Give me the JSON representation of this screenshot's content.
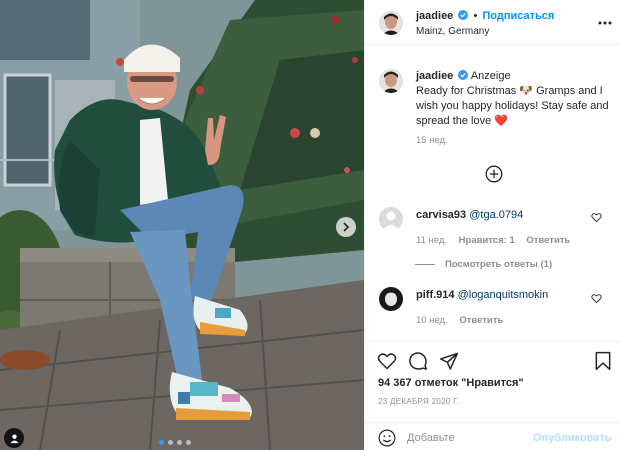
{
  "post": {
    "author": "jaadiee",
    "follow_label": "Подписаться",
    "separator": "•",
    "location": "Mainz, Germany",
    "more_icon": "more-horizontal-icon"
  },
  "caption": {
    "author": "jaadiee",
    "tag": "Anzeige",
    "text_start": "Ready for Christmas",
    "text_end": "Gramps and I wish you happy holidays! Stay safe and spread the love",
    "emoji_1": "🐶",
    "emoji_2": "❤️",
    "time": "15 нед."
  },
  "load_more_icon": "plus-circle-icon",
  "comments": [
    {
      "author": "carvisa93",
      "text": "@tga.0794",
      "time": "11 нед.",
      "likes_label": "Нравится: 1",
      "reply_label": "Ответить",
      "view_replies": "Посмотреть ответы (1)"
    },
    {
      "author": "piff.914",
      "text": "@loganquitsmokin",
      "time": "10 нед.",
      "reply_label": "Ответить"
    }
  ],
  "actions": {
    "likes": "94 367 отметок \"Нравится\"",
    "date": "23 ДЕКАБРЯ 2020 Г."
  },
  "add_comment": {
    "placeholder": "Добавьте комментарий...",
    "placeholder_visible": "Добавьте",
    "publish_label": "Опубликовать"
  },
  "colors": {
    "accent": "#0095f6",
    "publish_disabled": "#b2dffc",
    "secondary_text": "#8e8e8e",
    "heart_red": "#ed4956"
  },
  "carousel": {
    "slides": 4,
    "active": 1
  }
}
